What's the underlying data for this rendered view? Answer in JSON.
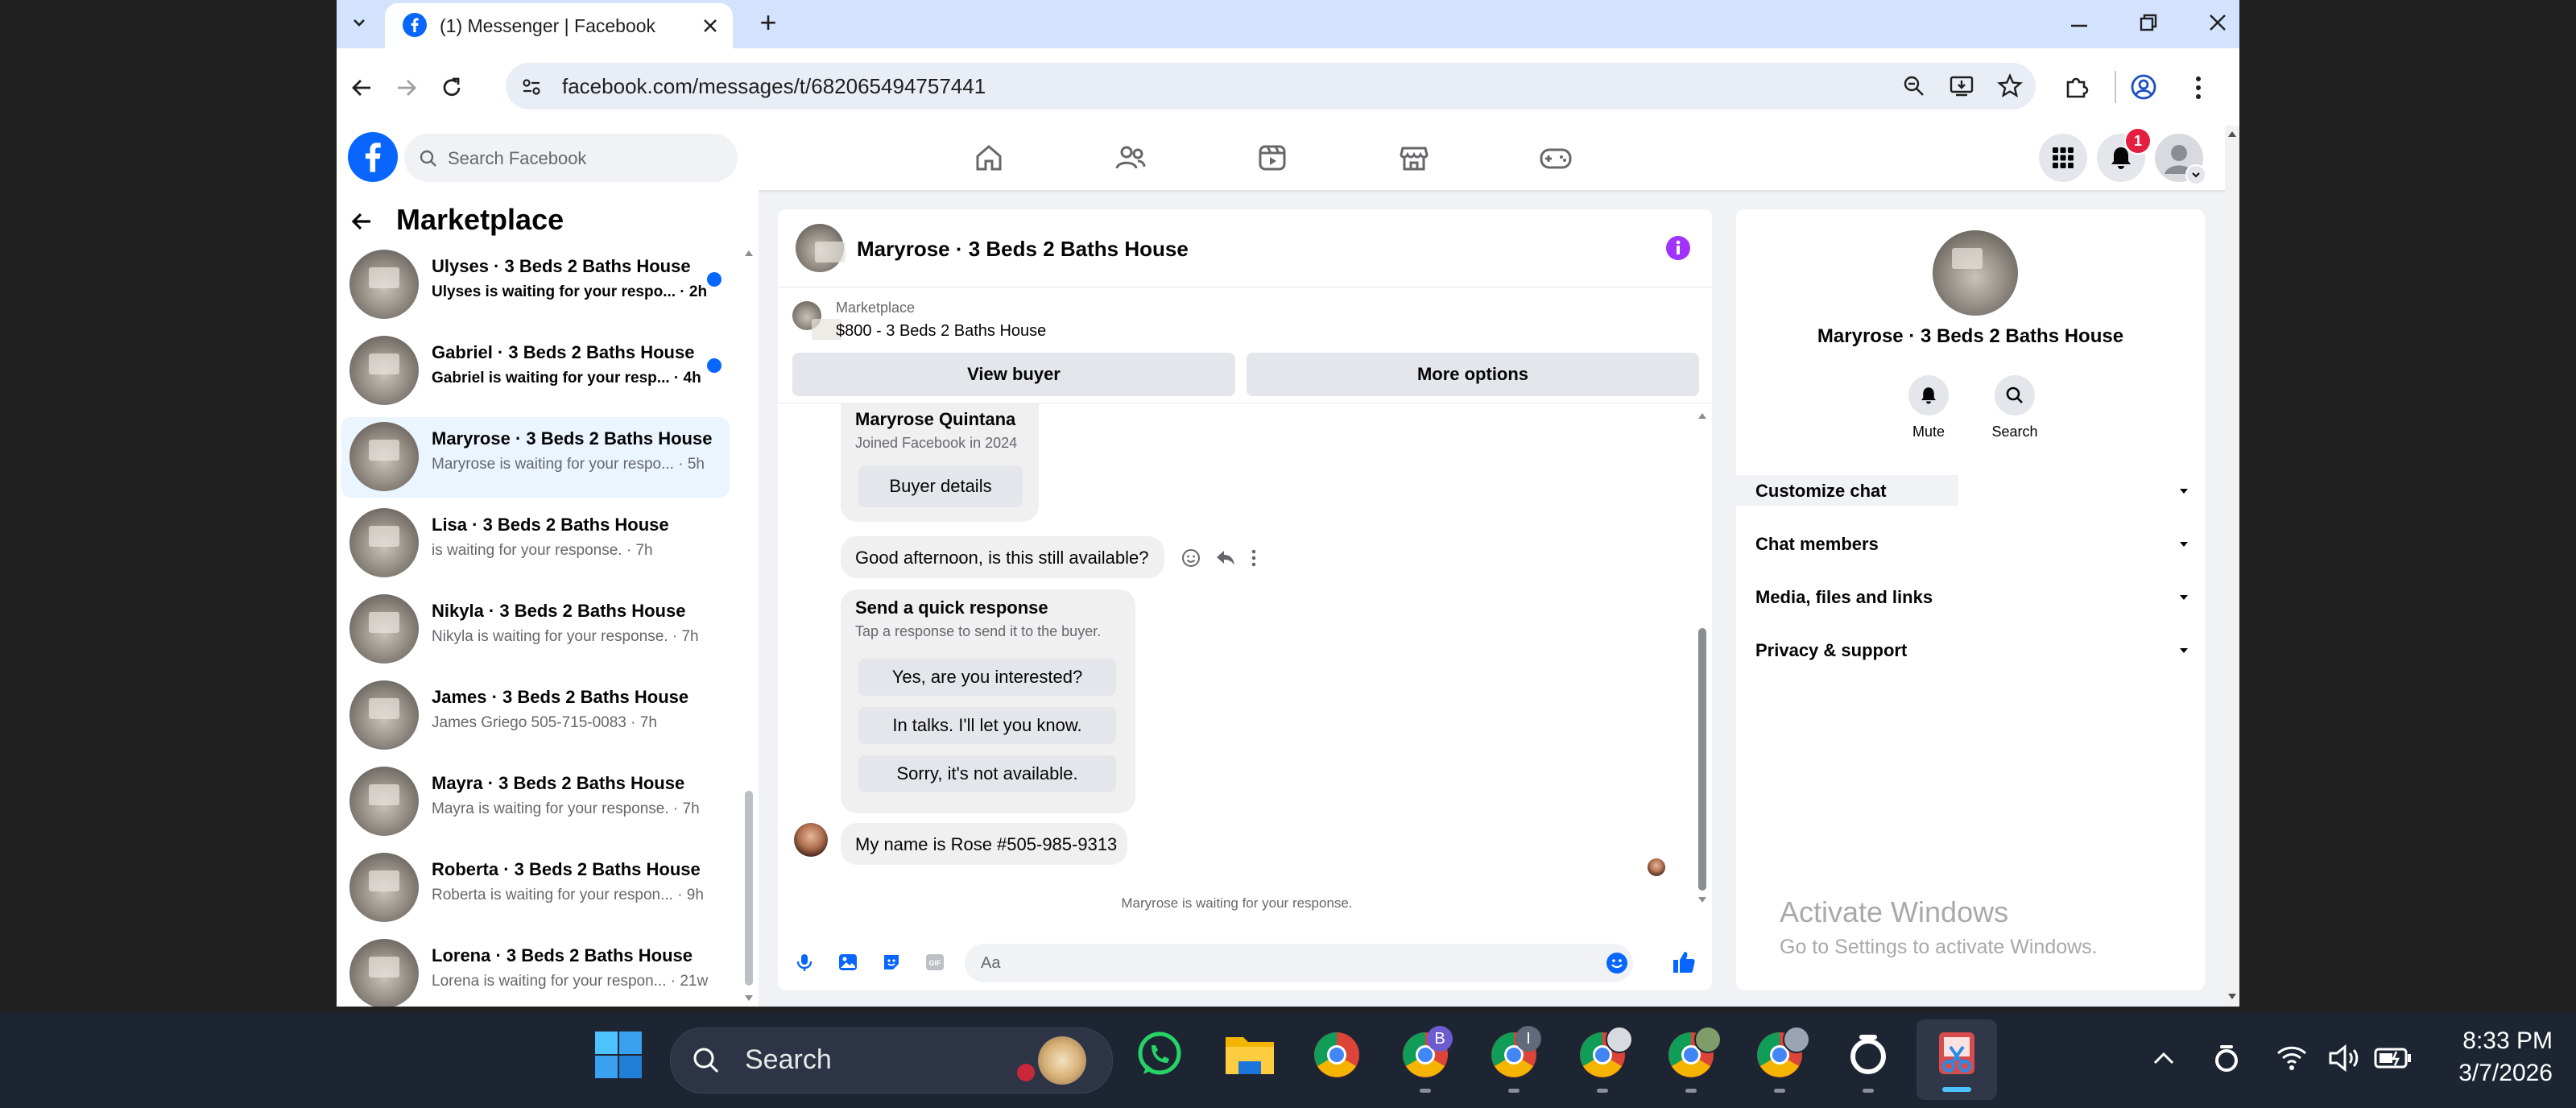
{
  "browser": {
    "tab_title": "(1) Messenger | Facebook",
    "new_tab": "+",
    "url": "facebook.com/messages/t/682065494757441"
  },
  "facebook": {
    "search_placeholder": "Search Facebook",
    "notification_count": "1",
    "brand_color": "#0866ff"
  },
  "sidebar": {
    "title": "Marketplace",
    "conversations": [
      {
        "name": "Ulyses · 3 Beds 2 Baths House",
        "preview": "Ulyses is waiting for your respo... · 2h",
        "unread": true
      },
      {
        "name": "Gabriel · 3 Beds 2 Baths House",
        "preview": "Gabriel is waiting for your resp... · 4h",
        "unread": true
      },
      {
        "name": "Maryrose · 3 Beds 2 Baths House",
        "preview": "Maryrose is waiting for your respo... · 5h",
        "selected": true
      },
      {
        "name": "Lisa · 3 Beds 2 Baths House",
        "preview": "is waiting for your response. · 7h"
      },
      {
        "name": "Nikyla · 3 Beds 2 Baths House",
        "preview": "Nikyla is waiting for your response. · 7h"
      },
      {
        "name": "James · 3 Beds 2 Baths House",
        "preview": "James Griego 505-715-0083 · 7h"
      },
      {
        "name": "Mayra · 3 Beds 2 Baths House",
        "preview": "Mayra is waiting for your response. · 7h"
      },
      {
        "name": "Roberta · 3 Beds 2 Baths House",
        "preview": "Roberta is waiting for your respon... · 9h"
      },
      {
        "name": "Lorena · 3 Beds 2 Baths House",
        "preview": "Lorena is waiting for your respon... · 21w"
      }
    ]
  },
  "chat": {
    "title": "Maryrose · 3 Beds 2 Baths House",
    "listing_label": "Marketplace",
    "listing_title": "$800 - 3 Beds 2 Baths House",
    "view_buyer": "View buyer",
    "more_options": "More options",
    "buyer_name": "Maryrose Quintana",
    "buyer_joined": "Joined Facebook in 2024",
    "buyer_details": "Buyer details",
    "message1": "Good afternoon, is this still available?",
    "quick_title": "Send a quick response",
    "quick_sub": "Tap a response to send it to the buyer.",
    "quick_replies": [
      "Yes, are you interested?",
      "In talks. I'll let you know.",
      "Sorry, it's not available."
    ],
    "message2": "My name is Rose #505-985-9313",
    "status": "Maryrose is waiting for your response.",
    "input_placeholder": "Aa"
  },
  "info_panel": {
    "name": "Maryrose · 3 Beds 2 Baths House",
    "mute": "Mute",
    "search": "Search",
    "sections": [
      "Customize chat",
      "Chat members",
      "Media, files and links",
      "Privacy & support"
    ],
    "watermark_title": "Activate Windows",
    "watermark_sub": "Go to Settings to activate Windows."
  },
  "taskbar": {
    "search": "Search",
    "time": "8:33 PM",
    "date": "3/7/2026",
    "badge_b": "B",
    "badge_i": "I"
  }
}
